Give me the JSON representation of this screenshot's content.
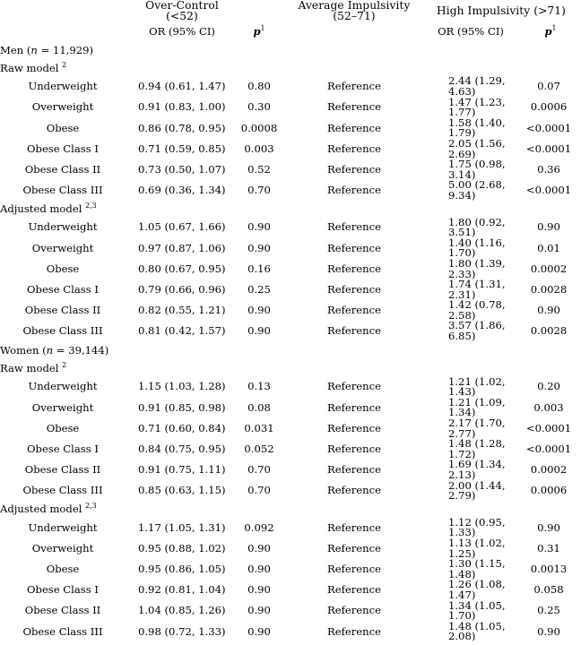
{
  "table": {
    "header": {
      "groups": [
        {
          "label": "",
          "key": "label"
        },
        {
          "label": "Over-Control (<52)",
          "key": "over_control"
        },
        {
          "label": "Average Impulsivity (52–71)",
          "key": "average_impulsivity"
        },
        {
          "label": "High Impulsivity (>71)",
          "key": "high_impulsivity"
        }
      ],
      "sub": {
        "or_label": "OR (95% CI)",
        "p_label": "p",
        "p_footnote": "1",
        "blank": ""
      }
    },
    "sections": [
      {
        "name": "men",
        "title_prefix": "Men (",
        "title_italic": "n",
        "title_suffix": " = 11,929)",
        "models": [
          {
            "name": "raw",
            "label": "Raw model",
            "footnote": "2",
            "rows": [
              {
                "label": "Underweight",
                "or1": "0.94 (0.61, 1.47)",
                "p1": "0.80",
                "ref": "Reference",
                "or2": "2.44 (1.29, 4.63)",
                "p2": "0.07"
              },
              {
                "label": "Overweight",
                "or1": "0.91 (0.83, 1.00)",
                "p1": "0.30",
                "ref": "Reference",
                "or2": "1.47 (1.23, 1.77)",
                "p2": "0.0006"
              },
              {
                "label": "Obese",
                "or1": "0.86 (0.78, 0.95)",
                "p1": "0.0008",
                "ref": "Reference",
                "or2": "1.58 (1.40, 1.79)",
                "p2": "<0.0001"
              },
              {
                "label": "Obese Class I",
                "or1": "0.71 (0.59, 0.85)",
                "p1": "0.003",
                "ref": "Reference",
                "or2": "2.05 (1.56, 2.69)",
                "p2": "<0.0001"
              },
              {
                "label": "Obese Class II",
                "or1": "0.73 (0.50, 1.07)",
                "p1": "0.52",
                "ref": "Reference",
                "or2": "1.75 (0.98, 3.14)",
                "p2": "0.36"
              },
              {
                "label": "Obese Class III",
                "or1": "0.69 (0.36, 1.34)",
                "p1": "0.70",
                "ref": "Reference",
                "or2": "5.00 (2.68, 9.34)",
                "p2": "<0.0001"
              }
            ]
          },
          {
            "name": "adjusted",
            "label": "Adjusted model",
            "footnote": "2,3",
            "rows": [
              {
                "label": "Underweight",
                "or1": "1.05 (0.67, 1.66)",
                "p1": "0.90",
                "ref": "Reference",
                "or2": "1.80 (0.92, 3.51)",
                "p2": "0.90"
              },
              {
                "label": "Overweight",
                "or1": "0.97 (0.87, 1.06)",
                "p1": "0.90",
                "ref": "Reference",
                "or2": "1.40 (1.16, 1.70)",
                "p2": "0.01"
              },
              {
                "label": "Obese",
                "or1": "0.80 (0.67, 0.95)",
                "p1": "0.16",
                "ref": "Reference",
                "or2": "1.80 (1.39, 2.33)",
                "p2": "0.0002"
              },
              {
                "label": "Obese Class I",
                "or1": "0.79 (0.66, 0.96)",
                "p1": "0.25",
                "ref": "Reference",
                "or2": "1.74 (1.31, 2.31)",
                "p2": "0.0028"
              },
              {
                "label": "Obese Class II",
                "or1": "0.82 (0.55, 1.21)",
                "p1": "0.90",
                "ref": "Reference",
                "or2": "1.42 (0.78, 2.58)",
                "p2": "0.90"
              },
              {
                "label": "Obese Class III",
                "or1": "0.81 (0.42, 1.57)",
                "p1": "0.90",
                "ref": "Reference",
                "or2": "3.57 (1.86, 6.85)",
                "p2": "0.0028"
              }
            ]
          }
        ]
      },
      {
        "name": "women",
        "title_prefix": "Women (",
        "title_italic": "n",
        "title_suffix": " = 39,144)",
        "models": [
          {
            "name": "raw",
            "label": "Raw model",
            "footnote": "2",
            "rows": [
              {
                "label": "Underweight",
                "or1": "1.15 (1.03, 1.28)",
                "p1": "0.13",
                "ref": "Reference",
                "or2": "1.21 (1.02, 1.43)",
                "p2": "0.20"
              },
              {
                "label": "Overweight",
                "or1": "0.91 (0.85, 0.98)",
                "p1": "0.08",
                "ref": "Reference",
                "or2": "1.21 (1.09, 1.34)",
                "p2": "0.003"
              },
              {
                "label": "Obese",
                "or1": "0.71 (0.60, 0.84)",
                "p1": "0.031",
                "ref": "Reference",
                "or2": "2.17 (1.70, 2.77)",
                "p2": "<0.0001"
              },
              {
                "label": "Obese Class I",
                "or1": "0.84 (0.75, 0.95)",
                "p1": "0.052",
                "ref": "Reference",
                "or2": "1.48 (1.28, 1.72)",
                "p2": "<0.0001"
              },
              {
                "label": "Obese Class II",
                "or1": "0.91 (0.75, 1.11)",
                "p1": "0.70",
                "ref": "Reference",
                "or2": "1.69 (1.34, 2.13)",
                "p2": "0.0002"
              },
              {
                "label": "Obese Class III",
                "or1": "0.85 (0.63, 1.15)",
                "p1": "0.70",
                "ref": "Reference",
                "or2": "2.00 (1.44, 2.79)",
                "p2": "0.0006"
              }
            ]
          },
          {
            "name": "adjusted",
            "label": "Adjusted model",
            "footnote": "2,3",
            "rows": [
              {
                "label": "Underweight",
                "or1": "1.17 (1.05, 1.31)",
                "p1": "0.092",
                "ref": "Reference",
                "or2": "1.12 (0.95, 1.33)",
                "p2": "0.90"
              },
              {
                "label": "Overweight",
                "or1": "0.95 (0.88, 1.02)",
                "p1": "0.90",
                "ref": "Reference",
                "or2": "1.13 (1.02, 1.25)",
                "p2": "0.31"
              },
              {
                "label": "Obese",
                "or1": "0.95 (0.86, 1.05)",
                "p1": "0.90",
                "ref": "Reference",
                "or2": "1.30 (1.15, 1.48)",
                "p2": "0.0013"
              },
              {
                "label": "Obese Class I",
                "or1": "0.92 (0.81, 1.04)",
                "p1": "0.90",
                "ref": "Reference",
                "or2": "1.26 (1.08, 1.47)",
                "p2": "0.058"
              },
              {
                "label": "Obese Class II",
                "or1": "1.04 (0.85, 1.26)",
                "p1": "0.90",
                "ref": "Reference",
                "or2": "1.34 (1.05, 1.70)",
                "p2": "0.25"
              },
              {
                "label": "Obese Class III",
                "or1": "0.98 (0.72, 1.33)",
                "p1": "0.90",
                "ref": "Reference",
                "or2": "1.48 (1.05, 2.08)",
                "p2": "0.90"
              }
            ]
          }
        ]
      }
    ]
  }
}
